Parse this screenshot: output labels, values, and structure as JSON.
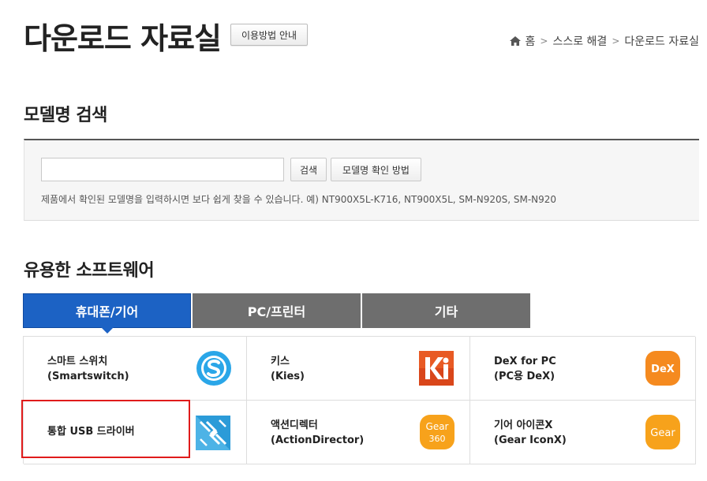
{
  "header": {
    "title": "다운로드 자료실",
    "guide_button": "이용방법 안내",
    "breadcrumb": [
      "홈",
      "스스로 해결",
      "다운로드 자료실"
    ]
  },
  "search": {
    "title": "모델명 검색",
    "input_value": "",
    "search_button": "검색",
    "check_button": "모델명 확인 방법",
    "help_text": "제품에서 확인된 모델명을 입력하시면 보다 쉽게 찾을 수 있습니다. 예) NT900X5L-K716, NT900X5L, SM-N920S, SM-N920"
  },
  "software": {
    "title": "유용한 소프트웨어",
    "tabs": [
      {
        "label": "휴대폰/기어",
        "active": true
      },
      {
        "label": "PC/프린터",
        "active": false
      },
      {
        "label": "기타",
        "active": false
      }
    ],
    "items": [
      {
        "line1": "스마트 스위치",
        "line2": "(Smartswitch)",
        "icon": "smartswitch-icon"
      },
      {
        "line1": "키스",
        "line2": "(Kies)",
        "icon": "kies-icon"
      },
      {
        "line1": "DeX for PC",
        "line2": "(PC용 DeX)",
        "icon": "dex-icon",
        "icon_text": "DeX"
      },
      {
        "line1": "통합 USB 드라이버",
        "line2": "",
        "icon": "usb-driver-icon"
      },
      {
        "line1": "액션디렉터",
        "line2": "(ActionDirector)",
        "icon": "gear360-icon",
        "icon_text1": "Gear",
        "icon_text2": "360"
      },
      {
        "line1": "기어 아이콘X",
        "line2": "(Gear IconX)",
        "icon": "gear-iconx-icon",
        "icon_text": "Gear"
      }
    ]
  },
  "colors": {
    "active_tab": "#1c62c4",
    "inactive_tab": "#6e6e6e",
    "highlight": "#e01b1b",
    "orange": "#f58a1f",
    "smartswitch_blue": "#2aa6e8"
  }
}
